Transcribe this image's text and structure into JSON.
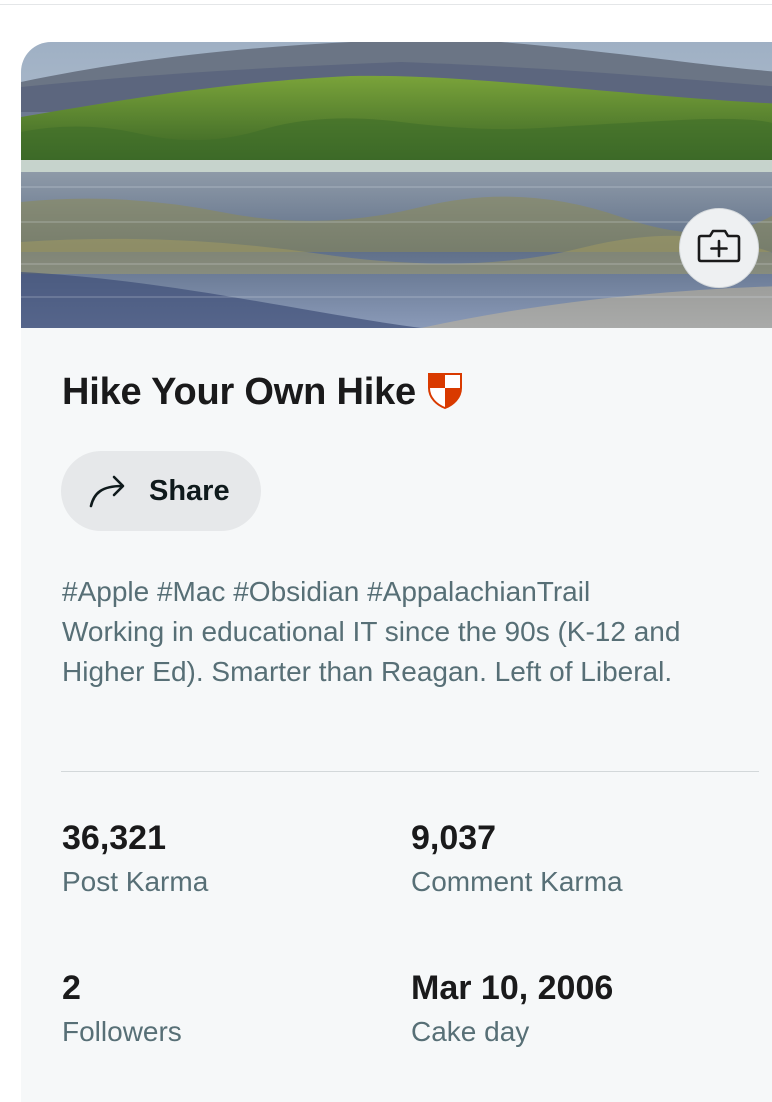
{
  "profile": {
    "name": "Hike Your Own Hike",
    "share_label": "Share",
    "bio_tags": "#Apple #Mac #Obsidian #AppalachianTrail",
    "bio_text": "Working in educational IT since the 90s (K-12 and Higher Ed). Smarter than Reagan. Left of Liberal."
  },
  "stats": {
    "post_karma": {
      "value": "36,321",
      "label": "Post Karma"
    },
    "comment_karma": {
      "value": "9,037",
      "label": "Comment Karma"
    },
    "followers": {
      "value": "2",
      "label": "Followers"
    },
    "cake_day": {
      "value": "Mar 10, 2006",
      "label": "Cake day"
    }
  },
  "icons": {
    "banner_edit": "camera-plus-icon",
    "share": "share-arrow-icon",
    "badge": "shield-badge-icon"
  },
  "colors": {
    "accent_badge": "#d93a00",
    "card_background": "#f6f8f9",
    "muted_text": "#576f76"
  }
}
